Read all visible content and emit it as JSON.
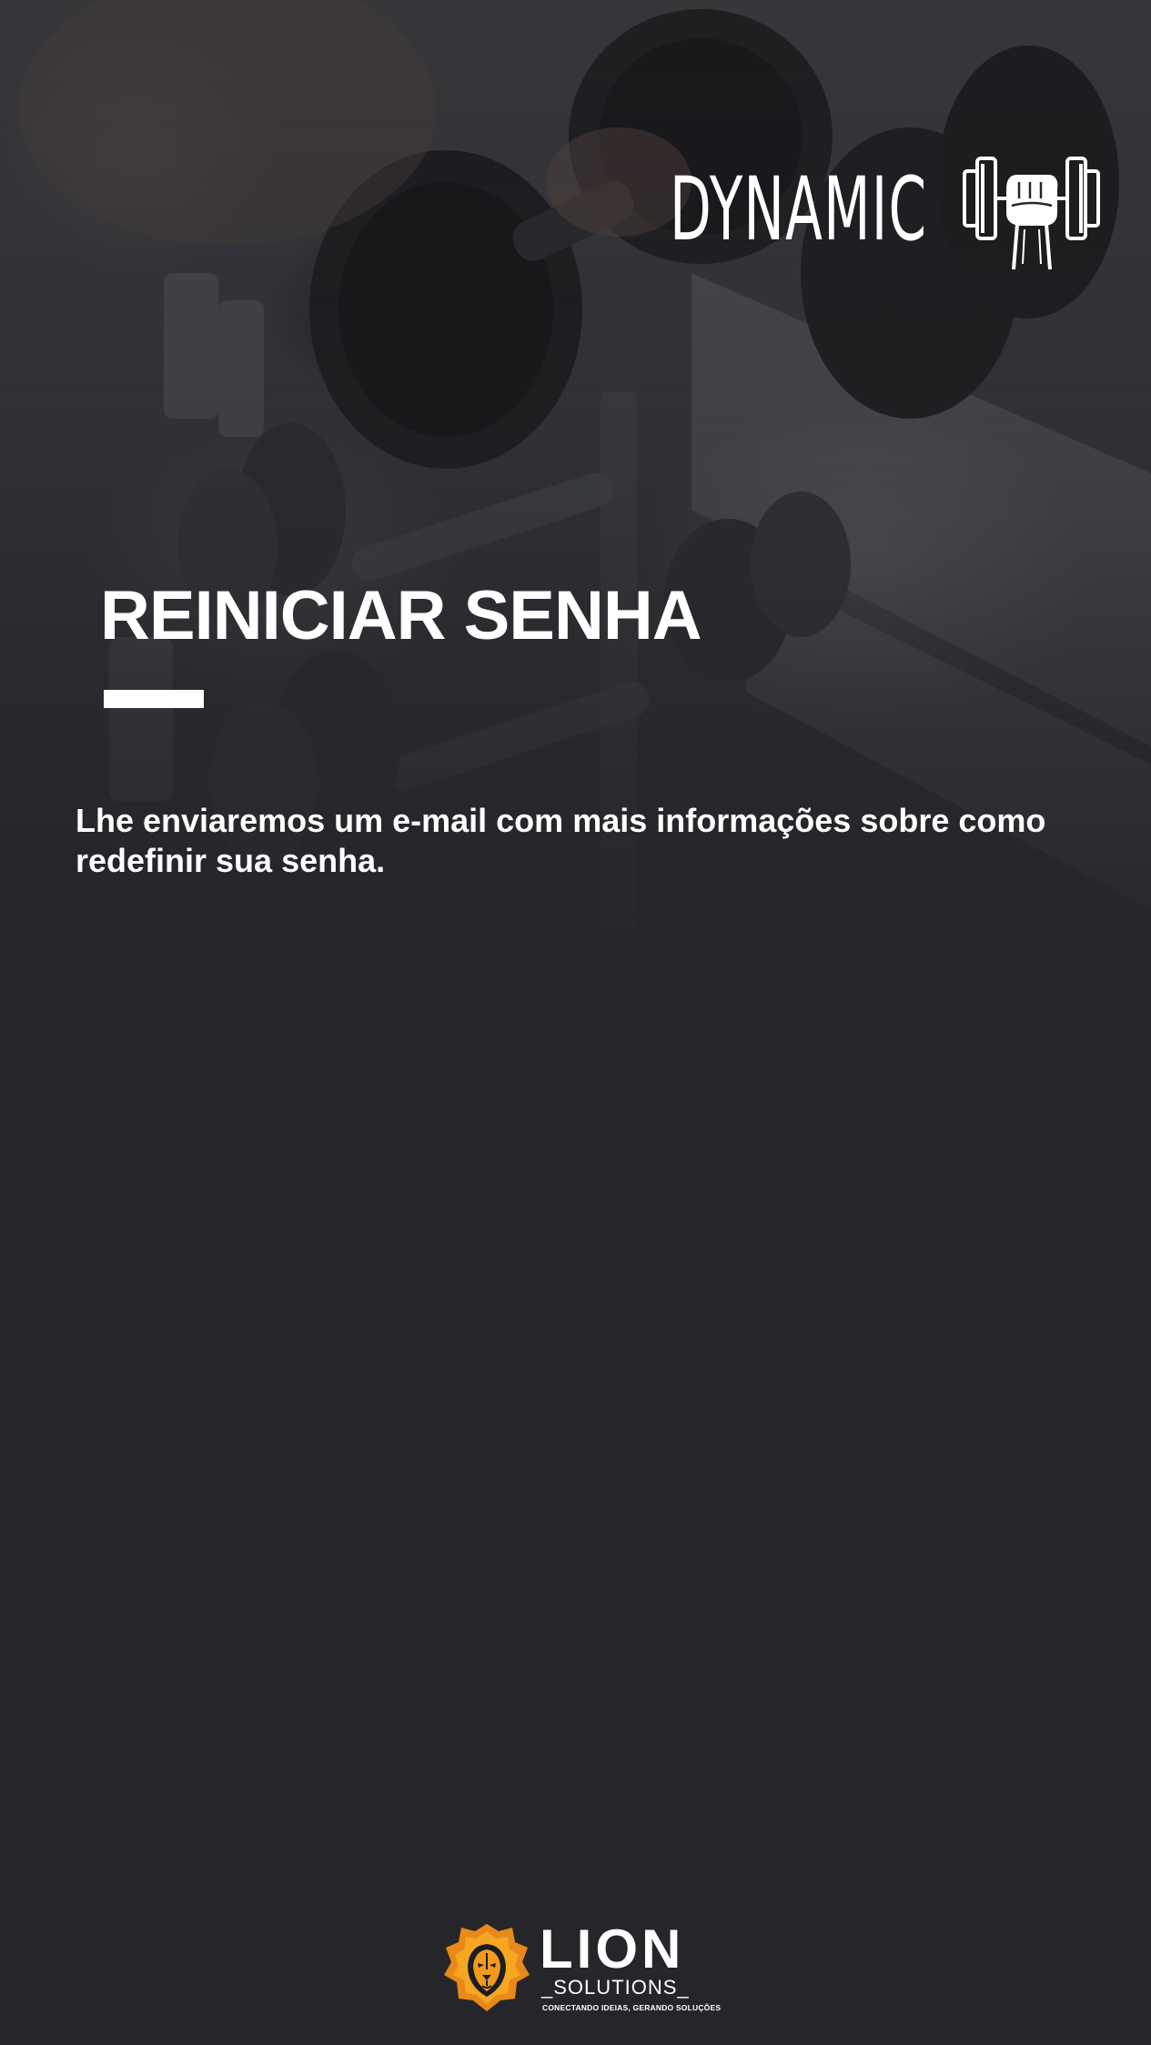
{
  "app": {
    "brand_name": "DYNAMIC",
    "brand_icon": "fist-dumbbell-icon"
  },
  "hero": {
    "background_image": "gym-dumbbell-rack-photo"
  },
  "main": {
    "title": "REINICIAR SENHA",
    "description": "Lhe enviaremos um e-mail com mais informações sobre como redefinir sua senha."
  },
  "footer": {
    "company_name": "LION",
    "company_sub": "SOLUTIONS",
    "tagline": "CONECTANDO IDEIAS, GERANDO SOLUÇÕES",
    "logo_icon": "lion-head-icon"
  },
  "colors": {
    "background": "#25262a",
    "text": "#ffffff",
    "accent_orange": "#f29a1f"
  }
}
